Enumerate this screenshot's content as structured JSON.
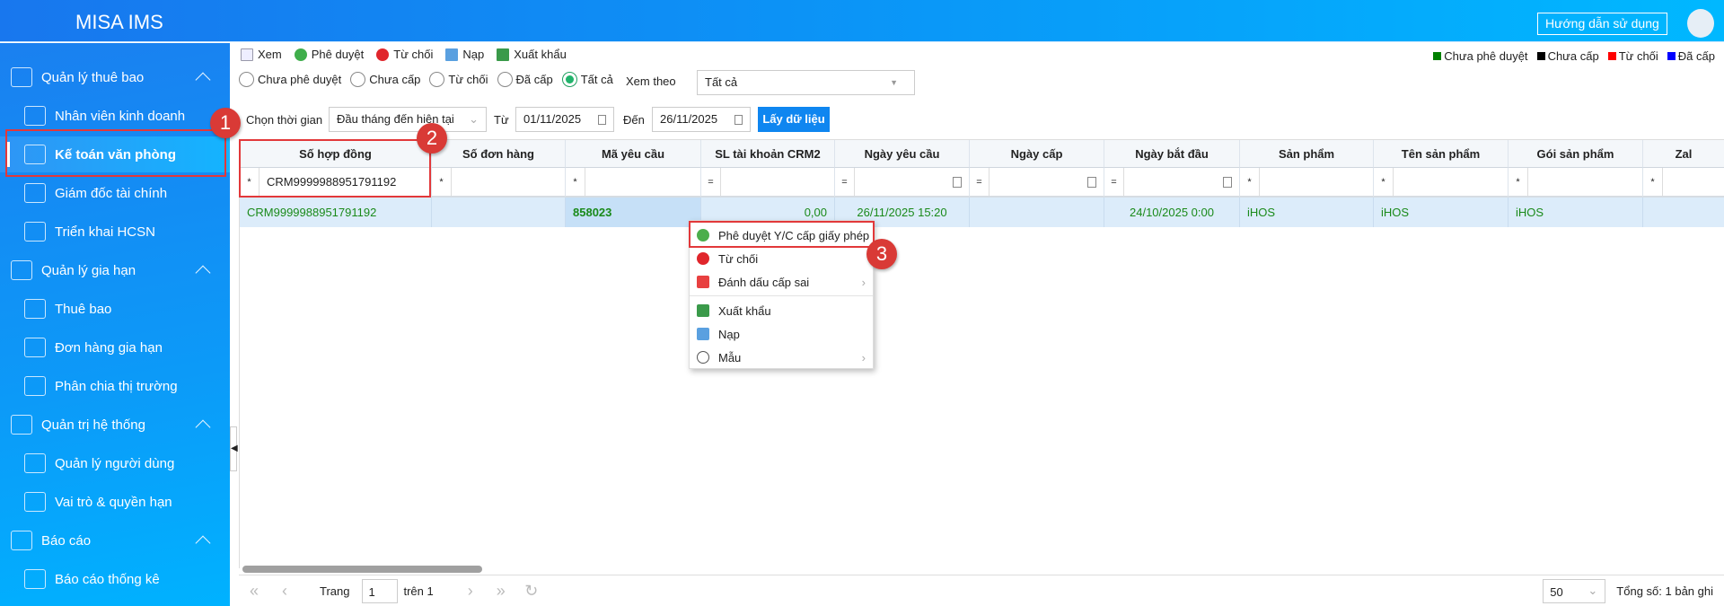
{
  "header": {
    "title": "MISA IMS",
    "help": "Hướng dẫn sử dụng"
  },
  "sidebar": {
    "items": [
      {
        "label": "Quản lý thuê bao",
        "type": "group"
      },
      {
        "label": "Nhân viên kinh doanh",
        "type": "sub"
      },
      {
        "label": "Kế toán văn phòng",
        "type": "sub",
        "active": true
      },
      {
        "label": "Giám đốc tài chính",
        "type": "sub"
      },
      {
        "label": "Triển khai HCSN",
        "type": "sub"
      },
      {
        "label": "Quản lý gia hạn",
        "type": "group"
      },
      {
        "label": "Thuê bao",
        "type": "sub"
      },
      {
        "label": "Đơn hàng gia hạn",
        "type": "sub"
      },
      {
        "label": "Phân chia thị trường",
        "type": "sub"
      },
      {
        "label": "Quản trị hệ thống",
        "type": "group"
      },
      {
        "label": "Quản lý người dùng",
        "type": "sub"
      },
      {
        "label": "Vai trò & quyền hạn",
        "type": "sub"
      },
      {
        "label": "Báo cáo",
        "type": "group"
      },
      {
        "label": "Báo cáo thống kê",
        "type": "sub"
      }
    ]
  },
  "toolbar": {
    "view": "Xem",
    "approve": "Phê duyệt",
    "reject": "Từ chối",
    "load": "Nạp",
    "export": "Xuất khẩu"
  },
  "legend": [
    {
      "label": "Chưa phê duyệt",
      "color": "#008000"
    },
    {
      "label": "Chưa cấp",
      "color": "#000000"
    },
    {
      "label": "Từ chối",
      "color": "#ff0000"
    },
    {
      "label": "Đã cấp",
      "color": "#0000ff"
    }
  ],
  "filters": {
    "radios": [
      "Chưa phê duyệt",
      "Chưa cấp",
      "Từ chối",
      "Đã cấp",
      "Tất cả"
    ],
    "selected": "Tất cả",
    "view_by_label": "Xem theo",
    "view_by_value": "Tất cả",
    "time_label": "Chọn thời gian",
    "time_value": "Đầu tháng đến hiện tại",
    "from_label": "Từ",
    "from": "01/11/2025",
    "to_label": "Đến",
    "to": "26/11/2025",
    "get_data": "Lấy dữ liệu"
  },
  "grid": {
    "columns": [
      "Số hợp đồng",
      "Số đơn hàng",
      "Mã yêu cầu",
      "SL tài khoản CRM2",
      "Ngày yêu cầu",
      "Ngày cấp",
      "Ngày bắt đầu",
      "Sản phẩm",
      "Tên sản phẩm",
      "Gói sản phẩm",
      "Zal"
    ],
    "filter_ops": [
      "*",
      "*",
      "*",
      "=",
      "=",
      "=",
      "=",
      "*",
      "*",
      "*",
      "*"
    ],
    "filter_values": [
      "CRM9999988951791192",
      "",
      "",
      "",
      "",
      "",
      "",
      "",
      "",
      "",
      ""
    ],
    "rows": [
      [
        "CRM9999988951791192",
        "",
        "858023",
        "0,00",
        "26/11/2025 15:20",
        "",
        "24/10/2025 0:00",
        "iHOS",
        "iHOS",
        "iHOS",
        ""
      ]
    ]
  },
  "context_menu": [
    {
      "label": "Phê duyệt Y/C cấp giấy phép",
      "icon": "check-circle-icon"
    },
    {
      "label": "Từ chối",
      "icon": "reject-icon"
    },
    {
      "label": "Đánh dấu cấp sai",
      "icon": "x-mark-icon",
      "submenu": true
    },
    {
      "label": "Xuất khẩu",
      "icon": "excel-icon"
    },
    {
      "label": "Nạp",
      "icon": "load-icon"
    },
    {
      "label": "Mẫu",
      "icon": "gear-icon",
      "submenu": true
    }
  ],
  "pager": {
    "page_label": "Trang",
    "page": "1",
    "of_label": "trên 1",
    "page_size": "50",
    "total": "Tổng số: 1 bản ghi"
  },
  "annotations": [
    "1",
    "2",
    "3"
  ]
}
